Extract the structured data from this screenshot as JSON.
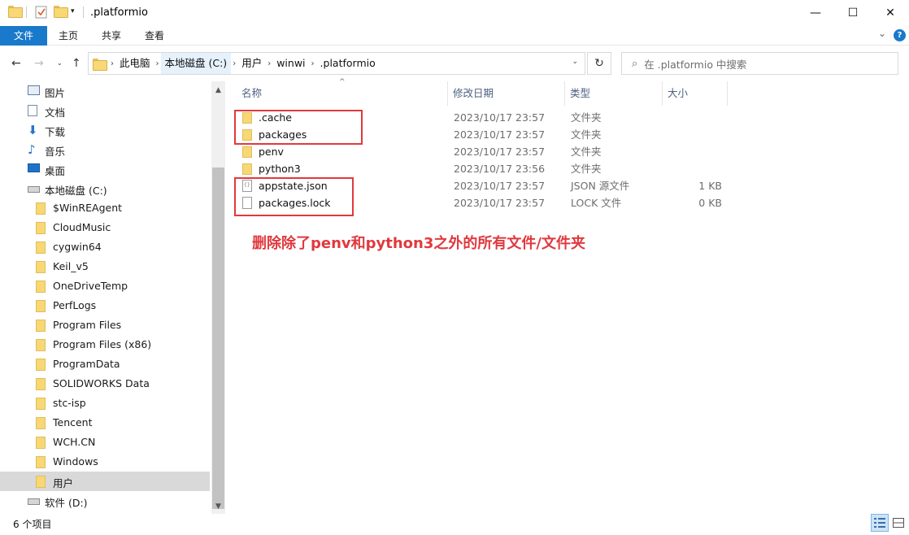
{
  "window": {
    "title": ".platformio",
    "minimize": "—",
    "maximize": "☐",
    "close": "✕"
  },
  "ribbon": {
    "tabs": [
      "文件",
      "主页",
      "共享",
      "查看"
    ],
    "collapse": "⌄",
    "help": "?"
  },
  "address": {
    "crumbs": [
      "此电脑",
      "本地磁盘 (C:)",
      "用户",
      "winwi",
      ".platformio"
    ],
    "search_placeholder": "在 .platformio 中搜索"
  },
  "sidebar": {
    "items": [
      {
        "label": "图片",
        "icon": "pictures-icon"
      },
      {
        "label": "文档",
        "icon": "documents-icon"
      },
      {
        "label": "下载",
        "icon": "download-icon"
      },
      {
        "label": "音乐",
        "icon": "music-icon"
      },
      {
        "label": "桌面",
        "icon": "desktop-icon"
      },
      {
        "label": "本地磁盘 (C:)",
        "icon": "drive-icon"
      },
      {
        "label": "$WinREAgent",
        "icon": "folder-icon"
      },
      {
        "label": "CloudMusic",
        "icon": "folder-icon"
      },
      {
        "label": "cygwin64",
        "icon": "folder-icon"
      },
      {
        "label": "Keil_v5",
        "icon": "folder-icon"
      },
      {
        "label": "OneDriveTemp",
        "icon": "folder-icon"
      },
      {
        "label": "PerfLogs",
        "icon": "folder-icon"
      },
      {
        "label": "Program Files",
        "icon": "folder-icon"
      },
      {
        "label": "Program Files (x86)",
        "icon": "folder-icon"
      },
      {
        "label": "ProgramData",
        "icon": "folder-icon"
      },
      {
        "label": "SOLIDWORKS Data",
        "icon": "folder-icon"
      },
      {
        "label": "stc-isp",
        "icon": "folder-icon"
      },
      {
        "label": "Tencent",
        "icon": "folder-icon"
      },
      {
        "label": "WCH.CN",
        "icon": "folder-icon"
      },
      {
        "label": "Windows",
        "icon": "folder-icon"
      },
      {
        "label": "用户",
        "icon": "folder-icon",
        "selected": true
      },
      {
        "label": "软件 (D:)",
        "icon": "drive-icon"
      }
    ]
  },
  "columns": {
    "name": "名称",
    "date": "修改日期",
    "type": "类型",
    "size": "大小"
  },
  "files": [
    {
      "name": ".cache",
      "date": "2023/10/17 23:57",
      "type": "文件夹",
      "size": "",
      "kind": "folder"
    },
    {
      "name": "packages",
      "date": "2023/10/17 23:57",
      "type": "文件夹",
      "size": "",
      "kind": "folder"
    },
    {
      "name": "penv",
      "date": "2023/10/17 23:57",
      "type": "文件夹",
      "size": "",
      "kind": "folder"
    },
    {
      "name": "python3",
      "date": "2023/10/17 23:56",
      "type": "文件夹",
      "size": "",
      "kind": "folder"
    },
    {
      "name": "appstate.json",
      "date": "2023/10/17 23:57",
      "type": "JSON 源文件",
      "size": "1 KB",
      "kind": "json"
    },
    {
      "name": "packages.lock",
      "date": "2023/10/17 23:57",
      "type": "LOCK 文件",
      "size": "0 KB",
      "kind": "file"
    }
  ],
  "annotation": "删除除了penv和python3之外的所有文件/文件夹",
  "status": {
    "count": "6 个项目"
  },
  "colors": {
    "accent": "#1979ca",
    "annotation": "#e0393e"
  }
}
